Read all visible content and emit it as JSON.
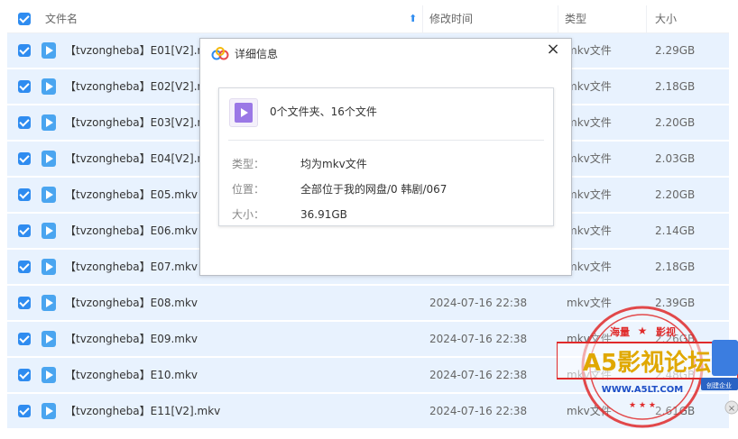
{
  "header": {
    "name_label": "文件名",
    "time_label": "修改时间",
    "type_label": "类型",
    "size_label": "大小"
  },
  "rows": [
    {
      "name": "【tvzongheba】E01[V2].mkv",
      "time": "",
      "type": "mkv文件",
      "size": "2.29GB"
    },
    {
      "name": "【tvzongheba】E02[V2].mkv",
      "time": "",
      "type": "mkv文件",
      "size": "2.18GB"
    },
    {
      "name": "【tvzongheba】E03[V2].mkv",
      "time": "",
      "type": "mkv文件",
      "size": "2.20GB"
    },
    {
      "name": "【tvzongheba】E04[V2].mkv",
      "time": "",
      "type": "mkv文件",
      "size": "2.03GB"
    },
    {
      "name": "【tvzongheba】E05.mkv",
      "time": "",
      "type": "mkv文件",
      "size": "2.20GB"
    },
    {
      "name": "【tvzongheba】E06.mkv",
      "time": "",
      "type": "mkv文件",
      "size": "2.14GB"
    },
    {
      "name": "【tvzongheba】E07.mkv",
      "time": "",
      "type": "mkv文件",
      "size": "2.18GB"
    },
    {
      "name": "【tvzongheba】E08.mkv",
      "time": "2024-07-16 22:38",
      "type": "mkv文件",
      "size": "2.39GB"
    },
    {
      "name": "【tvzongheba】E09.mkv",
      "time": "2024-07-16 22:38",
      "type": "mkv文件",
      "size": "2.26GB"
    },
    {
      "name": "【tvzongheba】E10.mkv",
      "time": "2024-07-16 22:38",
      "type": "mkv文件",
      "size": "2.48GB"
    },
    {
      "name": "【tvzongheba】E11[V2].mkv",
      "time": "2024-07-16 22:38",
      "type": "mkv文件",
      "size": "2.61GB"
    }
  ],
  "dialog": {
    "title": "详细信息",
    "close": "×",
    "summary": "0个文件夹、16个文件",
    "type_key": "类型：",
    "type_value": "均为mkv文件",
    "location_key": "位置：",
    "location_value": "全部位于我的网盘/0 韩剧/067",
    "size_key": "大小：",
    "size_value": "36.91GB"
  },
  "watermark": {
    "top_text": "海量 影视",
    "main_text": "A5影视论坛",
    "url": "WWW.A5LT.COM",
    "side_text": "创建企业"
  },
  "colors": {
    "accent": "#2f8cf0",
    "row_selected": "#e8f2fe",
    "stamp_red": "#e02b2b"
  }
}
